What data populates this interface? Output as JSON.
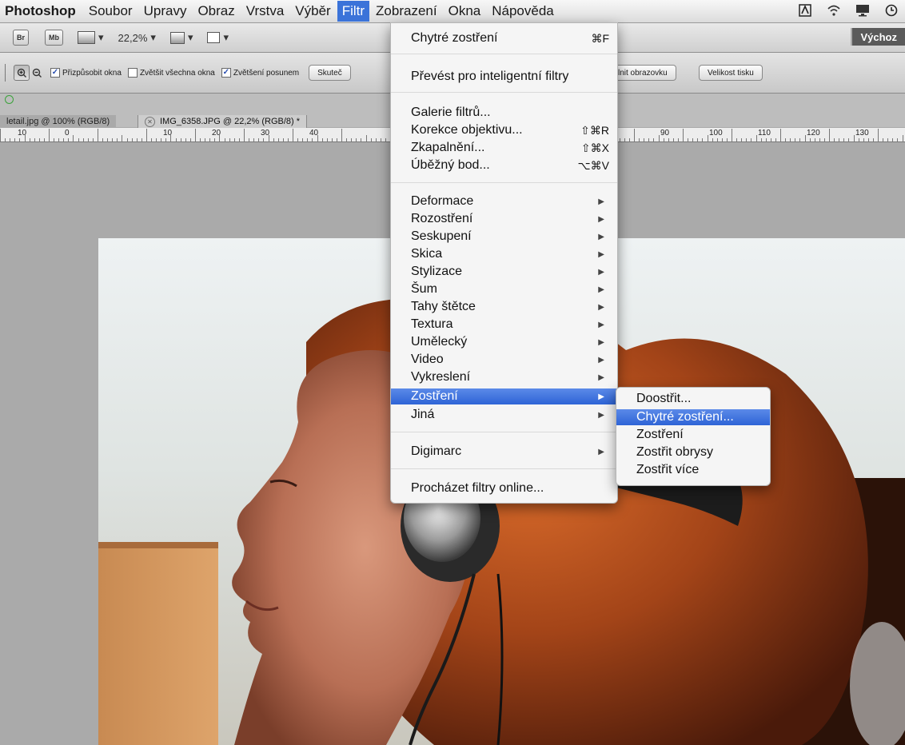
{
  "menubar": {
    "app_name": "Photoshop",
    "items": [
      {
        "label": "Soubor"
      },
      {
        "label": "Upravy"
      },
      {
        "label": "Obraz"
      },
      {
        "label": "Vrstva"
      },
      {
        "label": "Výběr"
      },
      {
        "label": "Filtr",
        "active": true
      },
      {
        "label": "Zobrazení"
      },
      {
        "label": "Okna"
      },
      {
        "label": "Nápověda"
      }
    ],
    "tray_icons": [
      "adobe-icon",
      "wifi-icon",
      "display-icon",
      "clock-icon"
    ]
  },
  "appbar": {
    "bridge_label": "Br",
    "minibridge_label": "Mb",
    "zoom_value": "22,2%",
    "workspace_label": "Výchoz"
  },
  "options_bar": {
    "checkbox_fit": {
      "label": "Přizpůsobit okna",
      "checked": true
    },
    "checkbox_zoom_all": {
      "label": "Zvětšit všechna okna",
      "checked": false
    },
    "checkbox_scrubby": {
      "label": "Zvětšení posunem",
      "checked": true
    },
    "actual_pixels_label": "Skuteč",
    "fill_screen_label": "ylnit obrazovku",
    "print_size_label": "Velikost tisku"
  },
  "tabs": [
    {
      "label": "letail.jpg @ 100% (RGB/8)",
      "active": false
    },
    {
      "label": "IMG_6358.JPG @ 22,2% (RGB/8) *",
      "active": true
    }
  ],
  "ruler": {
    "labels": [
      "10",
      "0",
      "10",
      "20",
      "30",
      "40",
      "90",
      "100",
      "110",
      "120",
      "130"
    ]
  },
  "filter_menu": {
    "group1": [
      {
        "label": "Chytré zostření",
        "shortcut": "⌘F"
      }
    ],
    "group2": [
      {
        "label": "Převést pro inteligentní filtry"
      }
    ],
    "group3": [
      {
        "label": "Galerie filtrů..."
      },
      {
        "label": "Korekce objektivu...",
        "shortcut": "⇧⌘R"
      },
      {
        "label": "Zkapalnění...",
        "shortcut": "⇧⌘X"
      },
      {
        "label": "Úběžný bod...",
        "shortcut": "⌥⌘V"
      }
    ],
    "group4": [
      {
        "label": "Deformace"
      },
      {
        "label": "Rozostření"
      },
      {
        "label": "Seskupení"
      },
      {
        "label": "Skica"
      },
      {
        "label": "Stylizace"
      },
      {
        "label": "Šum"
      },
      {
        "label": "Tahy štětce"
      },
      {
        "label": "Textura"
      },
      {
        "label": "Umělecký"
      },
      {
        "label": "Video"
      },
      {
        "label": "Vykreslení"
      },
      {
        "label": "Zostření",
        "selected": true
      },
      {
        "label": "Jiná"
      }
    ],
    "group5": [
      {
        "label": "Digimarc"
      }
    ],
    "group6": [
      {
        "label": "Procházet filtry online..."
      }
    ]
  },
  "sharpen_submenu": [
    {
      "label": "Doostřit..."
    },
    {
      "label": "Chytré zostření...",
      "selected": true
    },
    {
      "label": "Zostření"
    },
    {
      "label": "Zostřit obrysy"
    },
    {
      "label": "Zostřit více"
    }
  ],
  "colors": {
    "selection": "#2e64d6",
    "menu_bg": "#f5f5f5",
    "canvas_bg": "#aaaaaa"
  }
}
